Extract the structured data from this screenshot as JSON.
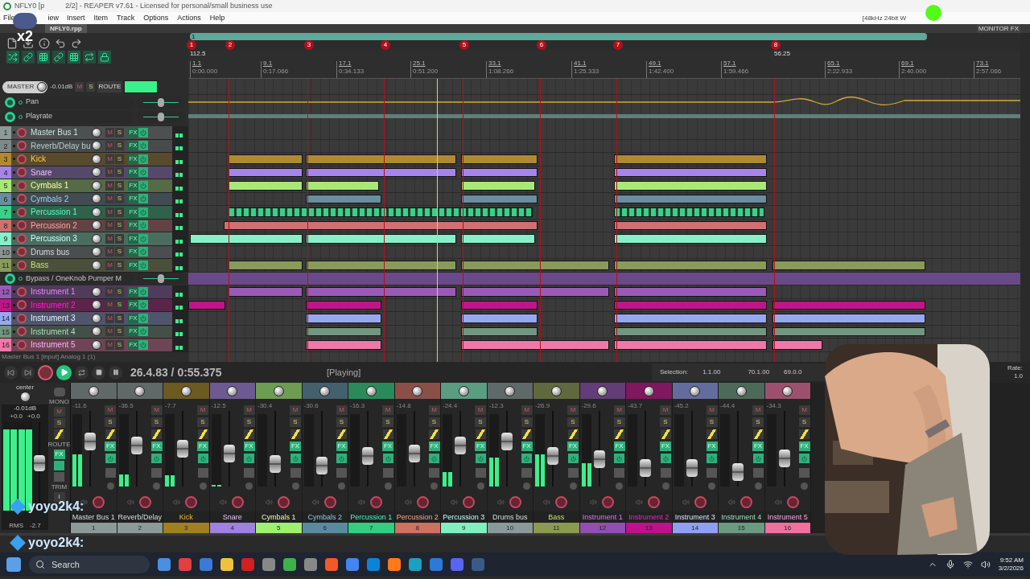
{
  "window": {
    "title_start": "NFLY0 [p",
    "title_end": "2/2] - REAPER v7.61 - Licensed for personal/small business use"
  },
  "menu": [
    "File",
    "iew",
    "Insert",
    "Item",
    "Track",
    "Options",
    "Actions",
    "Help"
  ],
  "audio_info": "[48kHz 24bit W",
  "monitor_fx": "MONITOR FX",
  "project_tab": "NFLY0.rpp",
  "overlay": {
    "multiplier": "x2",
    "chat": [
      {
        "user": "yoyo2k4:"
      },
      {
        "user": "yoyo2k4:"
      }
    ]
  },
  "master": {
    "label": "MASTER",
    "volume": "-0.01dB",
    "mute": "M",
    "solo": "S",
    "route": "ROUTE"
  },
  "envelopes": [
    {
      "name": "Pan",
      "level": 0.5
    },
    {
      "name": "Playrate",
      "level": 0.5
    }
  ],
  "bypass_envelope": {
    "name": "Bypass / OneKnob Pumper M",
    "level": 0.5
  },
  "tracks": [
    {
      "number": "1",
      "name": "Master Bus 1",
      "color": "#8c9a98",
      "m": "M",
      "s": "S",
      "fx": "FX"
    },
    {
      "number": "2",
      "name": "Reverb/Delay bu",
      "color": "#7d8a8a",
      "m": "M",
      "s": "S",
      "fx": "FX"
    },
    {
      "number": "3",
      "name": "Kick",
      "color": "#b08a30",
      "m": "M",
      "s": "S",
      "fx": "FX"
    },
    {
      "number": "4",
      "name": "Snare",
      "color": "#a684e8",
      "m": "M",
      "s": "S",
      "fx": "FX"
    },
    {
      "number": "5",
      "name": "Cymbals 1",
      "color": "#a8e878",
      "m": "M",
      "s": "S",
      "fx": "FX"
    },
    {
      "number": "6",
      "name": "Cymbals 2",
      "color": "#6a8ea0",
      "m": "M",
      "s": "S",
      "fx": "FX"
    },
    {
      "number": "7",
      "name": "Percussion 1",
      "color": "#3ad08a",
      "m": "M",
      "s": "S",
      "fx": "FX"
    },
    {
      "number": "8",
      "name": "Percussion 2",
      "color": "#d07070",
      "m": "M",
      "s": "S",
      "fx": "FX"
    },
    {
      "number": "9",
      "name": "Percussion 3",
      "color": "#88f0c8",
      "m": "M",
      "s": "S",
      "fx": "FX"
    },
    {
      "number": "10",
      "name": "Drums bus",
      "color": "#8a9494",
      "m": "M",
      "s": "S",
      "fx": "FX"
    },
    {
      "number": "11",
      "name": "Bass",
      "color": "#8a9a5a",
      "m": "M",
      "s": "S",
      "fx": "FX"
    },
    {
      "number": "12",
      "name": "Instrument 1",
      "color": "#9a5ab8",
      "m": "M",
      "s": "S",
      "fx": "FX"
    },
    {
      "number": "13",
      "name": "Instrument 2",
      "color": "#c0158a",
      "m": "M",
      "s": "S",
      "fx": "FX"
    },
    {
      "number": "14",
      "name": "Instrument 3",
      "color": "#98a8f0",
      "m": "M",
      "s": "S",
      "fx": "FX"
    },
    {
      "number": "15",
      "name": "Instrument 4",
      "color": "#72967f",
      "m": "M",
      "s": "S",
      "fx": "FX"
    },
    {
      "number": "16",
      "name": "Instrument 5",
      "color": "#f078a8",
      "m": "M",
      "s": "S",
      "fx": "FX"
    }
  ],
  "status_line": "Master Bus 1 [input] Analog 1 (1)",
  "arrange": {
    "loop_label": "1",
    "markers": [
      "1",
      "2",
      "3",
      "4",
      "5",
      "6",
      "7",
      "8"
    ],
    "tempos": [
      "112.5",
      "56.25"
    ],
    "ticks": [
      {
        "bar": "1.1",
        "time": "0:00.000"
      },
      {
        "bar": "9.1",
        "time": "0:17.066"
      },
      {
        "bar": "17.1",
        "time": "0:34.133"
      },
      {
        "bar": "25.1",
        "time": "0:51.200"
      },
      {
        "bar": "33.1",
        "time": "1:08.266"
      },
      {
        "bar": "41.1",
        "time": "1:25.333"
      },
      {
        "bar": "49.1",
        "time": "1:42.400"
      },
      {
        "bar": "57.1",
        "time": "1:59.466"
      },
      {
        "bar": "65.1",
        "time": "2:22.933"
      },
      {
        "bar": "69.1",
        "time": "2:40.000"
      },
      {
        "bar": "73.1",
        "time": "2:57.066"
      }
    ]
  },
  "transport": {
    "position": "26.4.83 / 0:55.375",
    "state": "[Playing]",
    "selection_label": "Selection:",
    "selection_start": "1.1.00",
    "selection_end": "70.1.00",
    "selection_length": "69.0.0",
    "rate_label": "Rate:",
    "rate": "1.0"
  },
  "master_strip": {
    "pan": "center",
    "volume": "-0.01dB",
    "peak_left": "+0.0",
    "peak_right": "+0.0",
    "meter_mode": "RMS",
    "rms": "-2.7",
    "mono": "MONO",
    "m": "M",
    "s": "S",
    "route": "ROUTE",
    "fx": "FX",
    "trim": "TRIM",
    "info": "i",
    "fader": {
      "level": 0.55
    },
    "meter": {
      "level": 0.92
    }
  },
  "mixer": [
    {
      "number": "1",
      "name": "Master Bus 1",
      "color": "#8c9a98",
      "reading": "-11.6",
      "m": "M",
      "s": "S",
      "fx": "FX",
      "fader": {
        "level": 0.63
      },
      "meter": {
        "level": 0.45
      }
    },
    {
      "number": "2",
      "name": "Reverb/Delay",
      "color": "#8c9a98",
      "reading": "-36.5",
      "m": "M",
      "s": "S",
      "fx": "FX",
      "fader": {
        "level": 0.55
      },
      "meter": {
        "level": 0.17
      }
    },
    {
      "number": "3",
      "name": "Kick",
      "color": "#a08020",
      "reading": "-7.7",
      "m": "M",
      "s": "S",
      "fx": "FX",
      "fader": {
        "level": 0.5
      },
      "meter": {
        "level": 0.16
      }
    },
    {
      "number": "4",
      "name": "Snare",
      "color": "#a080e0",
      "reading": "-12.5",
      "m": "M",
      "s": "S",
      "fx": "FX",
      "fader": {
        "level": 0.42
      },
      "meter": {
        "level": 0.02
      }
    },
    {
      "number": "5",
      "name": "Cymbals 1",
      "color": "#a0f070",
      "reading": "-30.4",
      "m": "M",
      "s": "S",
      "fx": "FX",
      "fader": {
        "level": 0.23
      },
      "meter": {
        "level": 0
      }
    },
    {
      "number": "6",
      "name": "Cymbals 2",
      "color": "#5a8aa0",
      "reading": "-30.6",
      "m": "M",
      "s": "S",
      "fx": "FX",
      "fader": {
        "level": 0.21
      },
      "meter": {
        "level": 0
      }
    },
    {
      "number": "7",
      "name": "Percussion 1",
      "color": "#30d080",
      "reading": "-16.3",
      "m": "M",
      "s": "S",
      "fx": "FX",
      "fader": {
        "level": 0.37
      },
      "meter": {
        "level": 0
      }
    },
    {
      "number": "8",
      "name": "Percussion 2",
      "color": "#d07060",
      "reading": "-14.8",
      "m": "M",
      "s": "S",
      "fx": "FX",
      "fader": {
        "level": 0.42
      },
      "meter": {
        "level": 0
      }
    },
    {
      "number": "9",
      "name": "Percussion 3",
      "color": "#80f0c0",
      "reading": "-24.4",
      "m": "M",
      "s": "S",
      "fx": "FX",
      "fader": {
        "level": 0.55
      },
      "meter": {
        "level": 0.2
      }
    },
    {
      "number": "10",
      "name": "Drums bus",
      "color": "#8a9a9a",
      "reading": "-12.3",
      "m": "M",
      "s": "S",
      "fx": "FX",
      "fader": {
        "level": 0.63
      },
      "meter": {
        "level": 0.4
      }
    },
    {
      "number": "11",
      "name": "Bass",
      "color": "#8a9a50",
      "reading": "-26.9",
      "m": "M",
      "s": "S",
      "fx": "FX",
      "fader": {
        "level": 0.37
      },
      "meter": {
        "level": 0.45
      }
    },
    {
      "number": "12",
      "name": "Instrument 1",
      "color": "#9050b0",
      "reading": "-29.6",
      "m": "M",
      "s": "S",
      "fx": "FX",
      "fader": {
        "level": 0.32
      },
      "meter": {
        "level": 0.32
      }
    },
    {
      "number": "13",
      "name": "Instrument 2",
      "color": "#c0108a",
      "reading": "-43.7",
      "m": "M",
      "s": "S",
      "fx": "FX",
      "fader": {
        "level": 0.16
      },
      "meter": {
        "level": 0
      }
    },
    {
      "number": "14",
      "name": "Instrument 3",
      "color": "#90a0f0",
      "reading": "-45.2",
      "m": "M",
      "s": "S",
      "fx": "FX",
      "fader": {
        "level": 0.16
      },
      "meter": {
        "level": 0
      }
    },
    {
      "number": "15",
      "name": "Instrument 4",
      "color": "#6a9a80",
      "reading": "-44.4",
      "m": "M",
      "s": "S",
      "fx": "FX",
      "fader": {
        "level": 0.1
      },
      "meter": {
        "level": 0
      }
    },
    {
      "number": "16",
      "name": "Instrument 5",
      "color": "#f070a0",
      "reading": "-34.3",
      "m": "M",
      "s": "S",
      "fx": "FX",
      "fader": {
        "level": 0.34
      },
      "meter": {
        "level": 0
      }
    }
  ],
  "taskbar": {
    "search": "Search",
    "time": "9:52 AM",
    "date": "3/2/2026"
  }
}
